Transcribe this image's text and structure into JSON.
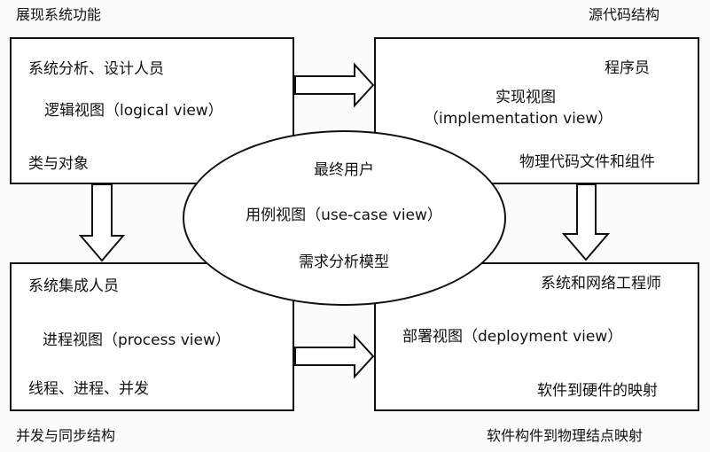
{
  "corners": {
    "top_left": "展现系统功能",
    "top_right": "源代码结构",
    "bottom_left": "并发与同步结构",
    "bottom_right": "软件构件到物理结点映射"
  },
  "boxes": {
    "logical": {
      "role": "系统分析、设计人员",
      "view": "逻辑视图（logical view）",
      "detail": "类与对象"
    },
    "implementation": {
      "role": "程序员",
      "view_line1": "实现视图",
      "view_line2": "（implementation view）",
      "detail": "物理代码文件和组件"
    },
    "process": {
      "role": "系统集成人员",
      "view": "进程视图（process view）",
      "detail": "线程、进程、并发"
    },
    "deployment": {
      "role": "系统和网络工程师",
      "view": "部署视图（deployment view）",
      "detail": "软件到硬件的映射"
    }
  },
  "center": {
    "role": "最终用户",
    "view": "用例视图（use-case view）",
    "detail": "需求分析模型"
  }
}
